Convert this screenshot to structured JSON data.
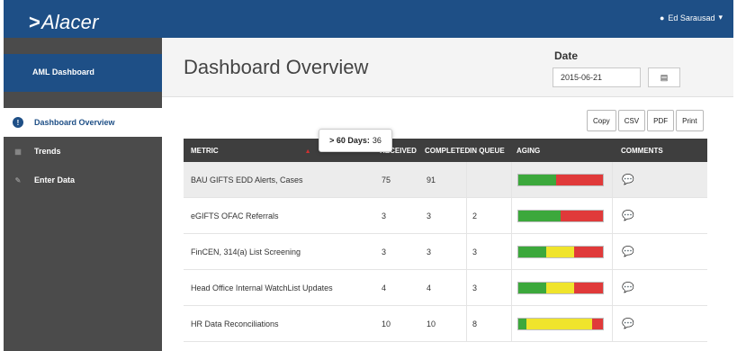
{
  "app": {
    "logo_mark": ">",
    "logo_text": "Alacer",
    "user_name": "Ed Sarausad"
  },
  "sidebar": {
    "header": "AML Dashboard",
    "items": [
      {
        "label": "Dashboard Overview",
        "icon": "info-icon",
        "active": true
      },
      {
        "label": "Trends",
        "icon": "chart-icon",
        "active": false
      },
      {
        "label": "Enter Data",
        "icon": "edit-icon",
        "active": false
      }
    ]
  },
  "page": {
    "title": "Dashboard Overview",
    "date_label": "Date",
    "date_value": "2015-06-21"
  },
  "export": [
    "Copy",
    "CSV",
    "PDF",
    "Print"
  ],
  "table": {
    "headers": [
      "METRIC",
      "RECEIVED",
      "COMPLETED",
      "IN QUEUE",
      "AGING",
      "COMMENTS"
    ],
    "rows": [
      {
        "metric": "BAU GIFTS EDD Alerts, Cases",
        "received": "75",
        "completed": "91",
        "in_queue": "",
        "aging": [
          0.45,
          0,
          0.55
        ]
      },
      {
        "metric": "eGIFTS OFAC Referrals",
        "received": "3",
        "completed": "3",
        "in_queue": "2",
        "aging": [
          0.5,
          0,
          0.5
        ]
      },
      {
        "metric": "FinCEN, 314(a) List Screening",
        "received": "3",
        "completed": "3",
        "in_queue": "3",
        "aging": [
          0.33,
          0.33,
          0.34
        ]
      },
      {
        "metric": "Head Office Internal WatchList Updates",
        "received": "4",
        "completed": "4",
        "in_queue": "3",
        "aging": [
          0.33,
          0.33,
          0.34
        ]
      },
      {
        "metric": "HR Data Reconciliations",
        "received": "10",
        "completed": "10",
        "in_queue": "8",
        "aging": [
          0.1,
          0.77,
          0.13
        ]
      }
    ]
  },
  "tooltip": {
    "label": "> 60 Days:",
    "value": "36"
  },
  "colors": {
    "brand": "#1e4f86",
    "aging_green": "#3ca83c",
    "aging_yellow": "#f0e42c",
    "aging_red": "#e03a3a"
  }
}
